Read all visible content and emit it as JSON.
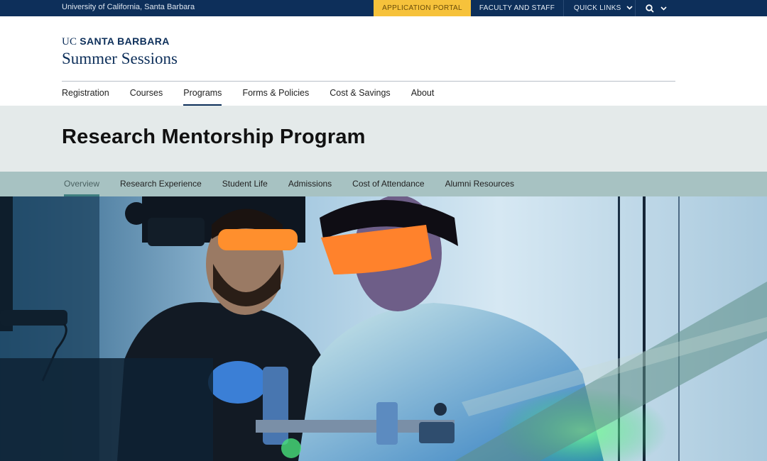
{
  "utility": {
    "university": "University of California, Santa Barbara",
    "portal": "APPLICATION PORTAL",
    "faculty": "FACULTY AND STAFF",
    "quick_links": "QUICK LINKS",
    "colors": {
      "bar": "#0d2f5a",
      "portal": "#f6c23b"
    }
  },
  "brand": {
    "uc": "UC",
    "santa_barbara": "SANTA BARBARA",
    "name": "Summer Sessions"
  },
  "main_nav": [
    "Registration",
    "Courses",
    "Programs",
    "Forms & Policies",
    "Cost & Savings",
    "About"
  ],
  "main_nav_active": "Programs",
  "page_title": "Research Mentorship Program",
  "sub_nav": [
    "Overview",
    "Research Experience",
    "Student Life",
    "Admissions",
    "Cost of Attendance",
    "Alumni Resources"
  ],
  "sub_nav_active": "Overview",
  "icons": {
    "search": "search-icon",
    "chevron": "chevron-down-icon"
  }
}
